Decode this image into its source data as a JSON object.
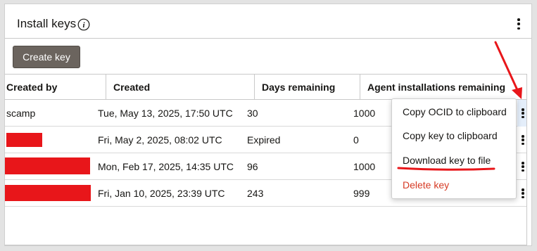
{
  "panel": {
    "title": "Install keys",
    "info_icon": "info-icon",
    "more_icon": "kebab-icon"
  },
  "toolbar": {
    "create_label": "Create key"
  },
  "table": {
    "columns": [
      "Created by",
      "Created",
      "Days remaining",
      "Agent installations remaining"
    ],
    "rows": [
      {
        "created_by": "scamp",
        "created": "Tue, May 13, 2025, 17:50 UTC",
        "days": "30",
        "installs": "1000"
      },
      {
        "created_by": "",
        "created": "Fri, May 2, 2025, 08:02 UTC",
        "days": "Expired",
        "installs": "0"
      },
      {
        "created_by": "",
        "created": "Mon, Feb 17, 2025, 14:35 UTC",
        "days": "96",
        "installs": "1000"
      },
      {
        "created_by": "",
        "created": "Fri, Jan 10, 2025, 23:39 UTC",
        "days": "243",
        "installs": "999"
      }
    ]
  },
  "menu": {
    "items": [
      "Copy OCID to clipboard",
      "Copy key to clipboard",
      "Download key to file",
      "Delete key"
    ]
  },
  "colors": {
    "primary_button": "#6b645e",
    "danger": "#d63b25",
    "annotation": "#e8161a",
    "active_row": "#e4eefa"
  }
}
